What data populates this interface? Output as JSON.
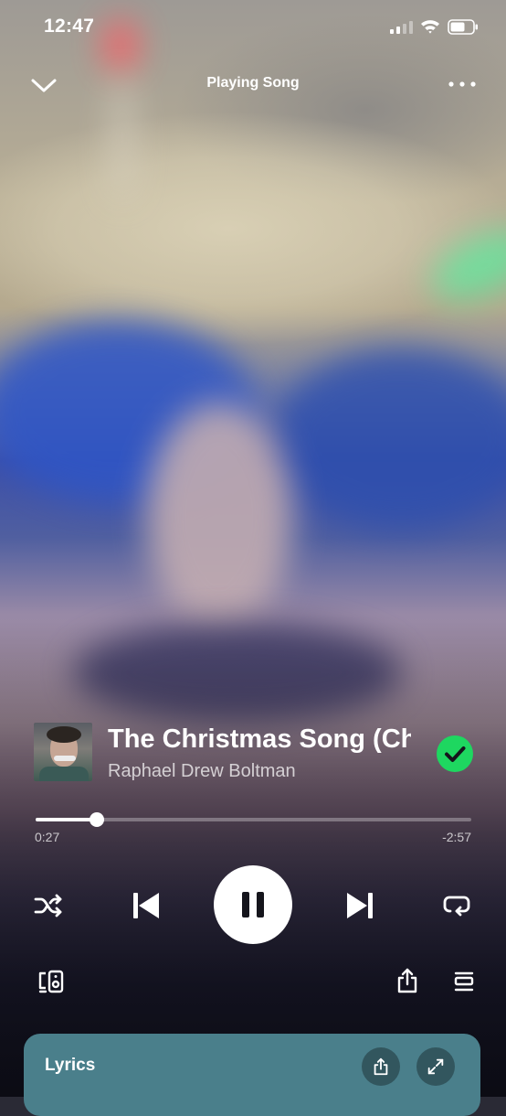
{
  "status_bar": {
    "time": "12:47"
  },
  "header": {
    "title": "Playing Song"
  },
  "track": {
    "title": "The Christmas Song (Ch",
    "artist": "Raphael Drew Boltman",
    "liked": true
  },
  "progress": {
    "elapsed": "0:27",
    "remaining": "-2:57",
    "fraction": 0.14
  },
  "controls": {
    "shuffle_icon": "shuffle-icon",
    "previous_icon": "skip-previous-icon",
    "play_state": "playing",
    "next_icon": "skip-next-icon",
    "repeat_icon": "repeat-icon"
  },
  "lyrics_card": {
    "label": "Lyrics"
  },
  "colors": {
    "accent_green": "#1ed760",
    "lyrics_card": "#4a7f8b"
  }
}
